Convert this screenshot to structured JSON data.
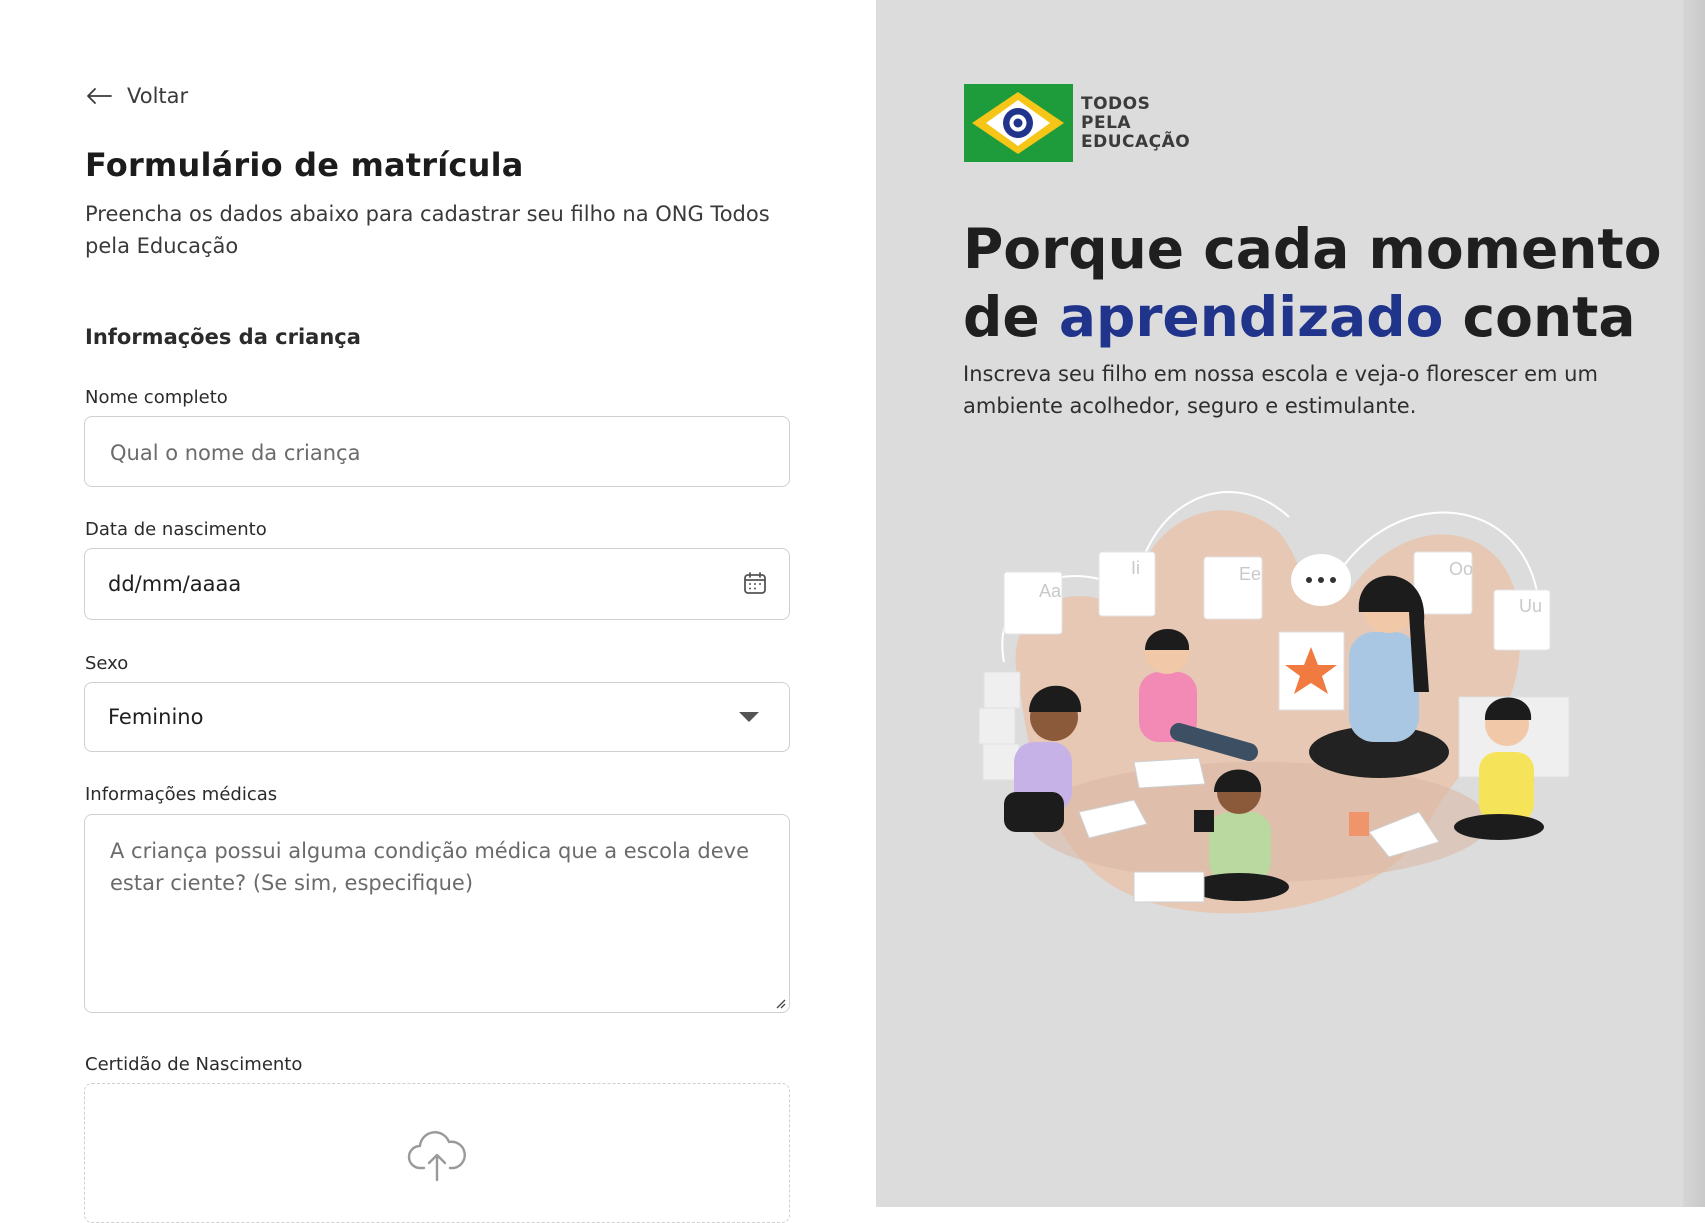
{
  "back": {
    "label": "Voltar"
  },
  "form": {
    "title": "Formulário de matrícula",
    "subtitle": "Preencha os dados abaixo para cadastrar seu filho na ONG Todos pela Educação",
    "section_title": "Informações da criança",
    "name": {
      "label": "Nome completo",
      "placeholder": "Qual o nome da criança"
    },
    "birth": {
      "label": "Data de nascimento",
      "placeholder": "dd/mm/aaaa"
    },
    "sex": {
      "label": "Sexo",
      "value": "Feminino"
    },
    "medical": {
      "label": "Informações médicas",
      "placeholder": "A criança possui alguma condição médica que a escola deve estar ciente? (Se sim, especifique)"
    },
    "certificate": {
      "label": "Certidão de Nascimento"
    }
  },
  "brand": {
    "logo_lines": [
      "TODOS",
      "PELA",
      "EDUCAÇÃO"
    ],
    "colors": {
      "green": "#1e9b3a",
      "yellow": "#f5c518",
      "blue": "#20348c"
    }
  },
  "hero": {
    "title_part1": "Porque cada momento de ",
    "title_accent": "aprendizado",
    "title_part2": " conta",
    "subtitle": "Inscreva seu filho em nossa escola e veja-o florescer em um ambiente acolhedor, seguro e estimulante."
  },
  "icons": [
    "arrow-left-icon",
    "calendar-icon",
    "chevron-down-icon",
    "cloud-upload-icon"
  ]
}
